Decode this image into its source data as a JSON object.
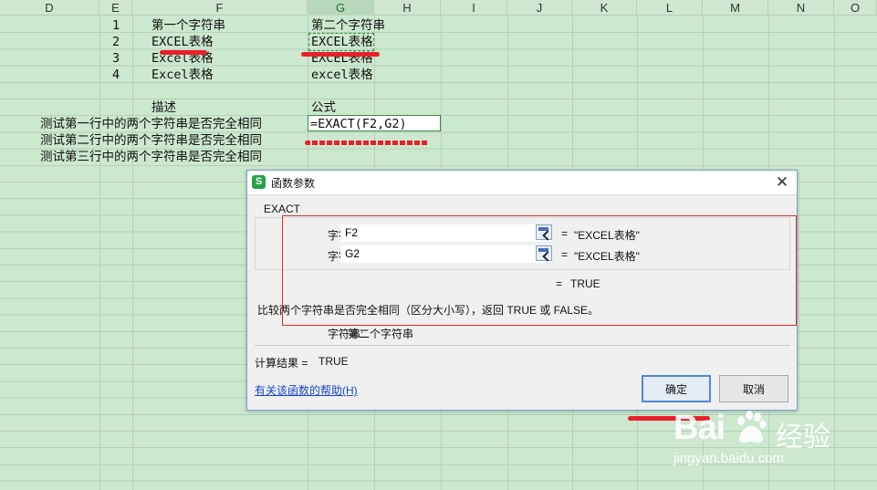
{
  "columns": [
    "D",
    "E",
    "F",
    "G",
    "H",
    "I",
    "J",
    "K",
    "L",
    "M",
    "N",
    "O"
  ],
  "selected_column": "G",
  "sheet": {
    "rows": [
      {
        "index": "1",
        "str1": "第一个字符串",
        "str2": "第二个字符串"
      },
      {
        "index": "2",
        "str1": "EXCEL表格",
        "str2": "EXCEL表格"
      },
      {
        "index": "3",
        "str1": "Excel表格",
        "str2": "EXCEL表格"
      },
      {
        "index": "4",
        "str1": "Excel表格",
        "str2": "excel表格"
      }
    ],
    "desc_header": "描述",
    "formula_header": "公式",
    "descriptions": [
      "测试第一行中的两个字符串是否完全相同",
      "测试第二行中的两个字符串是否完全相同",
      "测试第三行中的两个字符串是否完全相同"
    ],
    "active_formula": "=EXACT(F2,G2)"
  },
  "dialog": {
    "title": "函数参数",
    "function_name": "EXACT",
    "args": [
      {
        "label": "字符串",
        "value": "F2",
        "result": "\"EXCEL表格\""
      },
      {
        "label": "字符串",
        "value": "G2",
        "result": "\"EXCEL表格\""
      }
    ],
    "equals": "=",
    "result": "TRUE",
    "description": "比较两个字符串是否完全相同（区分大小写），返回 TRUE 或 FALSE。",
    "param_label": "字符串:",
    "param_desc": "第二个字符串",
    "calc_label": "计算结果 =",
    "calc_value": "TRUE",
    "help_link": "有关该函数的帮助(H)",
    "ok_label": "确定",
    "cancel_label": "取消",
    "close_icon": "close-icon",
    "app_icon_letter": "S"
  },
  "watermark": {
    "brand_left": "Bai",
    "brand_right": "经验",
    "url": "jingyan.baidu.com"
  },
  "colors": {
    "sheet_bg": "#cce8cf",
    "accent": "#2f8a3c",
    "annotation_red": "#e8202a"
  }
}
